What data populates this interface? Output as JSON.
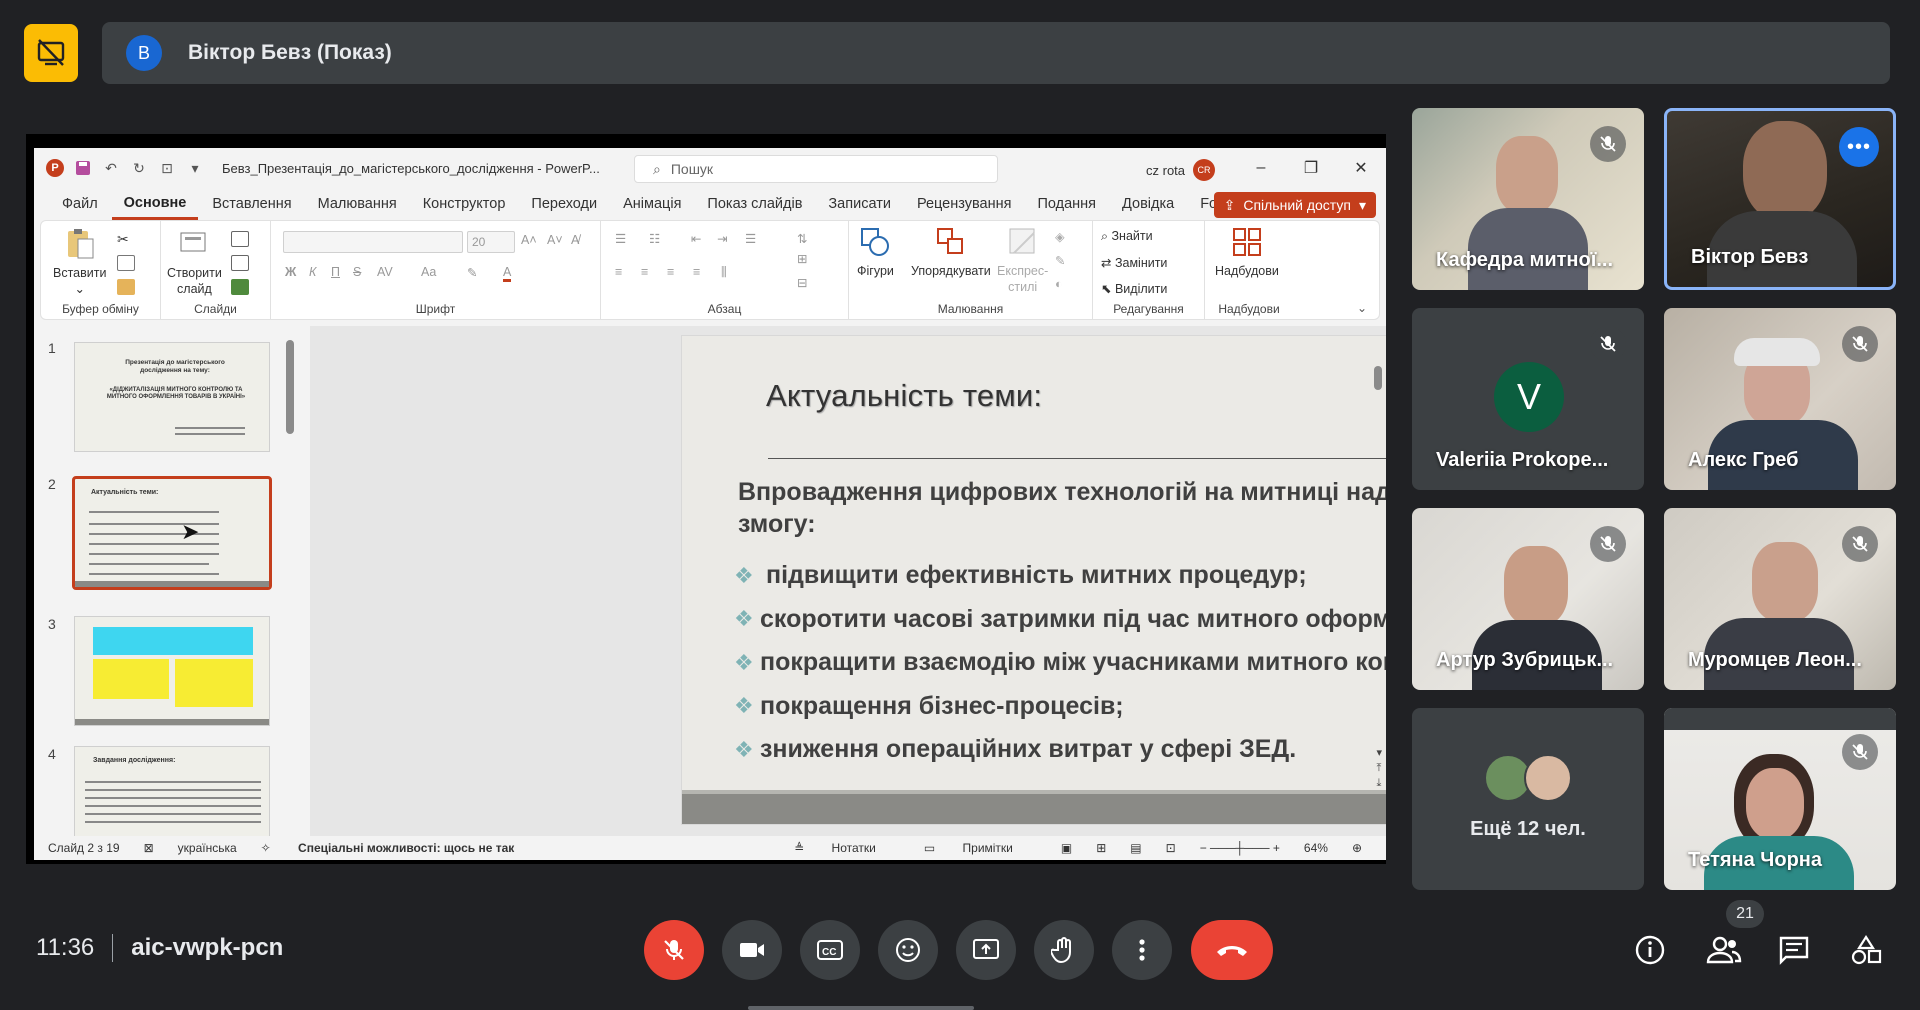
{
  "presenting": {
    "avatar_letter": "В",
    "title": "Віктор Бевз (Показ)"
  },
  "ppt": {
    "filename": "Бевз_Презентація_до_магістерського_дослідження - PowerP...",
    "search_placeholder": "Пошук",
    "user_name": "cz rota",
    "user_initials": "CR",
    "tabs": [
      "Файл",
      "Основне",
      "Вставлення",
      "Малювання",
      "Конструктор",
      "Переходи",
      "Анімація",
      "Показ слайдів",
      "Записати",
      "Рецензування",
      "Подання",
      "Довідка",
      "Foxit PDF"
    ],
    "active_tab": "Основне",
    "share_label": "Спільний доступ",
    "ribbon": {
      "paste": "Вставити",
      "clipboard_group": "Буфер обміну",
      "new_slide_line1": "Створити",
      "new_slide_line2": "слайд",
      "slides_group": "Слайди",
      "font_size": "20",
      "font_group": "Шрифт",
      "paragraph_group": "Абзац",
      "shapes": "Фігури",
      "arrange": "Упорядкувати",
      "quick_styles_line1": "Експрес-",
      "quick_styles_line2": "стилі",
      "drawing_group": "Малювання",
      "find": "Знайти",
      "replace": "Замінити",
      "select": "Виділити",
      "editing_group": "Редагування",
      "addins": "Надбудови",
      "addins_group": "Надбудови"
    },
    "thumbnails": [
      {
        "num": "1",
        "title": "Презентація до магістерського дослідження на тему:",
        "subtitle": "«ДІДЖИТАЛІЗАЦІЯ МИТНОГО КОНТРОЛЮ ТА МИТНОГО ОФОРМЛЕННЯ ТОВАРІВ В УКРАЇНІ»"
      },
      {
        "num": "2",
        "title": "Актуальність теми:"
      },
      {
        "num": "3",
        "title": ""
      },
      {
        "num": "4",
        "title": "Завдання дослідження:"
      }
    ],
    "slide": {
      "title": "Актуальність теми:",
      "intro": "Впровадження цифрових технологій на митниці надає змогу:",
      "bullets": [
        "підвищити ефективність митних процедур;",
        "скоротити часові затримки під час митного оформлення;",
        "покращити взаємодію між учасниками митного контролю;",
        "покращення бізнес-процесів;",
        "зниження операційних витрат у сфері ЗЕД."
      ]
    },
    "status": {
      "slide_counter": "Слайд 2 з 19",
      "language": "українська",
      "accessibility": "Спеціальні можливості: щось не так",
      "notes": "Нотатки",
      "comments": "Примітки",
      "zoom": "64%"
    }
  },
  "participants": [
    {
      "name": "Кафедра митної...",
      "muted": true
    },
    {
      "name": "Віктор Бевз",
      "muted": false,
      "speaking": true
    },
    {
      "name": "Valeriia Prokope...",
      "muted": true,
      "avatar_letter": "V"
    },
    {
      "name": "Алекс Греб",
      "muted": true
    },
    {
      "name": "Артур Зубрицьк...",
      "muted": true
    },
    {
      "name": "Муромцев Леон...",
      "muted": true
    },
    {
      "name": "Ещё 12 чел.",
      "muted": false
    },
    {
      "name": "Тетяна Чорна",
      "muted": true
    }
  ],
  "footer": {
    "time": "11:36",
    "meeting_code": "aic-vwpk-pcn",
    "participant_count": "21"
  },
  "colors": {
    "background": "#202124",
    "present_badge": "#fbbc04",
    "end_call": "#ea4335",
    "ppt_accent": "#c43e1c",
    "speaker_ring": "#8ab4f8"
  }
}
